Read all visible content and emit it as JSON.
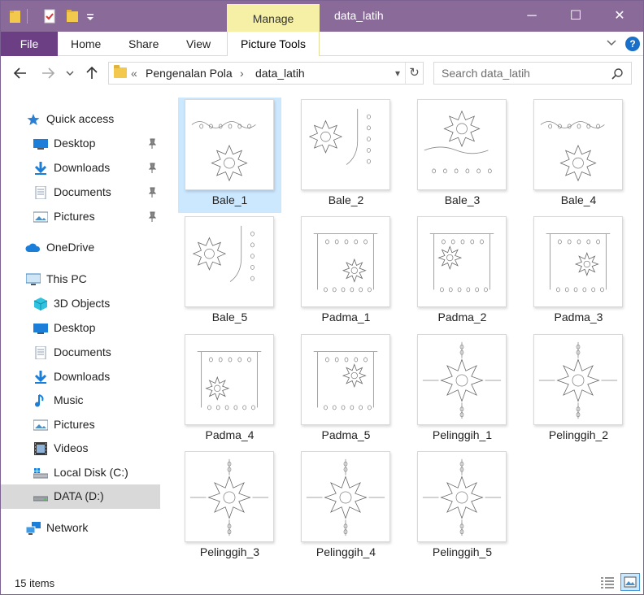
{
  "window": {
    "title": "data_latih",
    "contextual_tab": "Manage",
    "controls": {
      "minimize": "─",
      "maximize": "☐",
      "close": "✕"
    }
  },
  "ribbon": {
    "file": "File",
    "tabs": [
      "Home",
      "Share",
      "View"
    ],
    "picture_tools": "Picture Tools"
  },
  "address": {
    "overflow": "«",
    "crumbs": [
      "Pengenalan Pola",
      "data_latih"
    ],
    "separator": "›"
  },
  "search": {
    "placeholder": "Search data_latih"
  },
  "sidebar": {
    "quick_access": "Quick access",
    "quick_items": [
      {
        "label": "Desktop",
        "icon": "desktop-icon"
      },
      {
        "label": "Downloads",
        "icon": "downloads-icon"
      },
      {
        "label": "Documents",
        "icon": "documents-icon"
      },
      {
        "label": "Pictures",
        "icon": "pictures-icon"
      }
    ],
    "onedrive": "OneDrive",
    "this_pc": "This PC",
    "pc_items": [
      {
        "label": "3D Objects",
        "icon": "3d-objects-icon"
      },
      {
        "label": "Desktop",
        "icon": "desktop-icon"
      },
      {
        "label": "Documents",
        "icon": "documents-icon"
      },
      {
        "label": "Downloads",
        "icon": "downloads-icon"
      },
      {
        "label": "Music",
        "icon": "music-icon"
      },
      {
        "label": "Pictures",
        "icon": "pictures-icon"
      },
      {
        "label": "Videos",
        "icon": "videos-icon"
      },
      {
        "label": "Local Disk (C:)",
        "icon": "local-disk-icon"
      },
      {
        "label": "DATA (D:)",
        "icon": "drive-icon"
      }
    ],
    "network": "Network"
  },
  "files": [
    {
      "name": "Bale_1",
      "pattern": "bale"
    },
    {
      "name": "Bale_2",
      "pattern": "bale"
    },
    {
      "name": "Bale_3",
      "pattern": "bale"
    },
    {
      "name": "Bale_4",
      "pattern": "bale"
    },
    {
      "name": "Bale_5",
      "pattern": "bale"
    },
    {
      "name": "Padma_1",
      "pattern": "padma"
    },
    {
      "name": "Padma_2",
      "pattern": "padma"
    },
    {
      "name": "Padma_3",
      "pattern": "padma"
    },
    {
      "name": "Padma_4",
      "pattern": "padma"
    },
    {
      "name": "Padma_5",
      "pattern": "padma"
    },
    {
      "name": "Pelinggih_1",
      "pattern": "pelinggih"
    },
    {
      "name": "Pelinggih_2",
      "pattern": "pelinggih"
    },
    {
      "name": "Pelinggih_3",
      "pattern": "pelinggih"
    },
    {
      "name": "Pelinggih_4",
      "pattern": "pelinggih"
    },
    {
      "name": "Pelinggih_5",
      "pattern": "pelinggih"
    }
  ],
  "selected_file": "Bale_1",
  "status": {
    "item_count": "15 items"
  },
  "colors": {
    "titlebar": "#8a6a99",
    "file_tab": "#6c3f84",
    "manage_tab": "#f6f0a6",
    "selection": "#cce8ff"
  }
}
